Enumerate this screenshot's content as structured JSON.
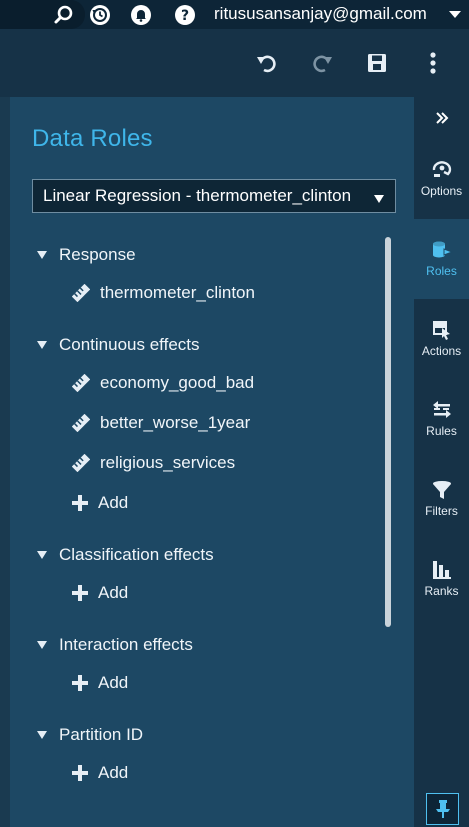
{
  "header": {
    "user_email": "ritususansanjay@gmail.com",
    "icons": [
      "search-icon",
      "history-icon",
      "notifications-icon",
      "help-icon",
      "chevron-down-icon"
    ]
  },
  "toolbar": {
    "icons": [
      "undo-icon",
      "redo-icon",
      "save-icon",
      "more-vertical-icon"
    ]
  },
  "panel": {
    "title": "Data Roles",
    "model_select_value": "Linear Regression - thermometer_clinton",
    "sections": [
      {
        "label": "Response",
        "items": [
          "thermometer_clinton"
        ],
        "has_add": false
      },
      {
        "label": "Continuous effects",
        "items": [
          "economy_good_bad",
          "better_worse_1year",
          "religious_services"
        ],
        "has_add": true
      },
      {
        "label": "Classification effects",
        "items": [],
        "has_add": true
      },
      {
        "label": "Interaction effects",
        "items": [],
        "has_add": true
      },
      {
        "label": "Partition ID",
        "items": [],
        "has_add": true
      }
    ],
    "add_label": "Add"
  },
  "rail": {
    "items": [
      {
        "label": "Options",
        "icon": "options-icon",
        "active": false
      },
      {
        "label": "Roles",
        "icon": "roles-icon",
        "active": true
      },
      {
        "label": "Actions",
        "icon": "actions-icon",
        "active": false
      },
      {
        "label": "Rules",
        "icon": "rules-icon",
        "active": false
      },
      {
        "label": "Filters",
        "icon": "filter-icon",
        "active": false
      },
      {
        "label": "Ranks",
        "icon": "ranks-icon",
        "active": false
      }
    ]
  },
  "colors": {
    "accent": "#3fb6ea",
    "panel_bg": "#1d4864",
    "app_bg": "#163247"
  }
}
